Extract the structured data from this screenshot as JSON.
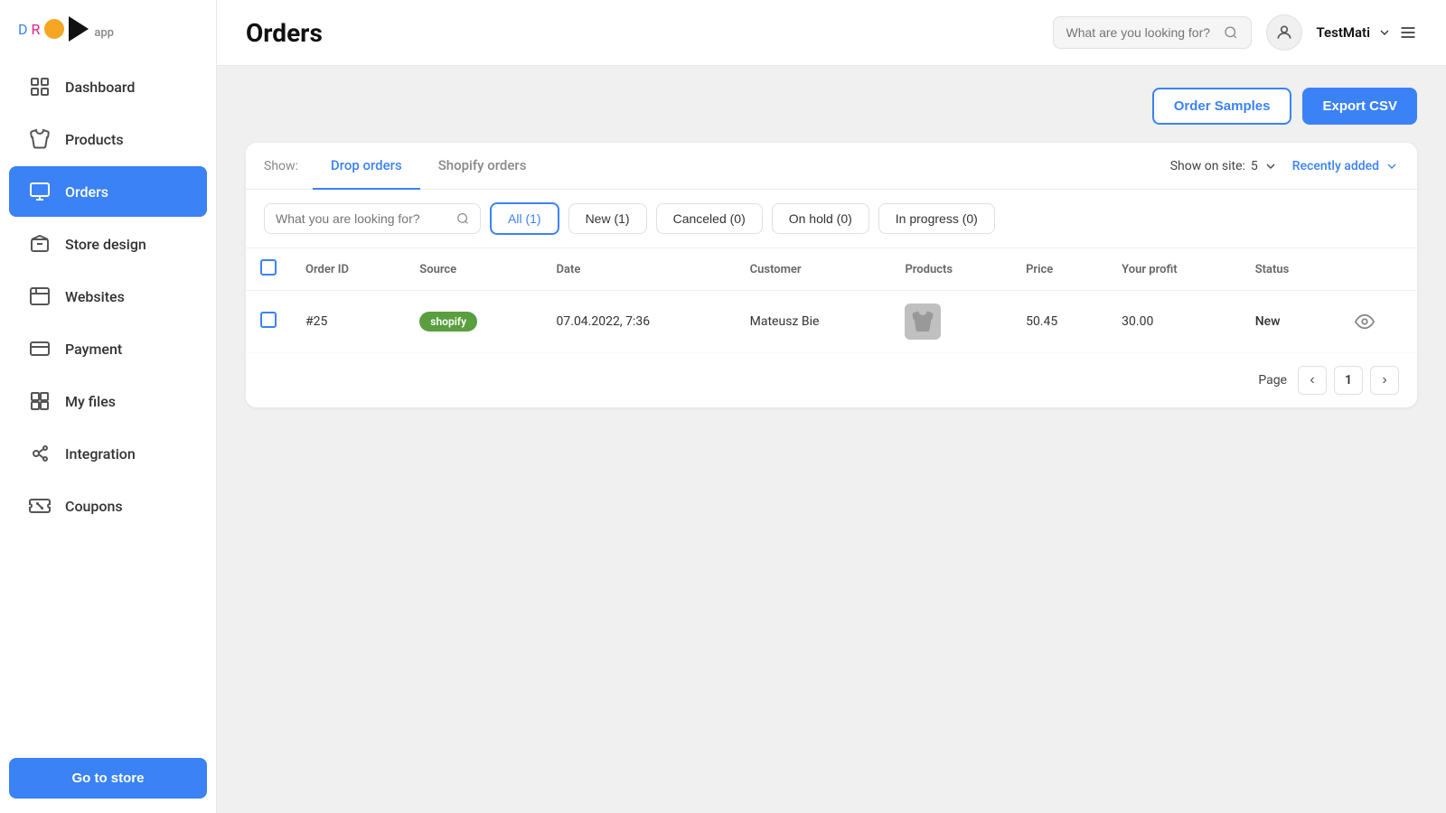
{
  "sidebar": {
    "logo": {
      "drop": "DROP",
      "app": "app"
    },
    "nav_items": [
      {
        "id": "dashboard",
        "label": "Dashboard",
        "active": false
      },
      {
        "id": "products",
        "label": "Products",
        "active": false
      },
      {
        "id": "orders",
        "label": "Orders",
        "active": true
      },
      {
        "id": "store-design",
        "label": "Store design",
        "active": false
      },
      {
        "id": "websites",
        "label": "Websites",
        "active": false
      },
      {
        "id": "payment",
        "label": "Payment",
        "active": false
      },
      {
        "id": "my-files",
        "label": "My files",
        "active": false
      },
      {
        "id": "integration",
        "label": "Integration",
        "active": false
      },
      {
        "id": "coupons",
        "label": "Coupons",
        "active": false
      }
    ],
    "go_to_store": "Go to store"
  },
  "header": {
    "title": "Orders",
    "search_placeholder": "What are you looking for?",
    "user": "TestMati"
  },
  "actions": {
    "order_samples": "Order Samples",
    "export_csv": "Export CSV"
  },
  "tabs": {
    "show_label": "Show:",
    "items": [
      {
        "id": "drop-orders",
        "label": "Drop orders",
        "active": true
      },
      {
        "id": "shopify-orders",
        "label": "Shopify orders",
        "active": false
      }
    ],
    "show_on_site_label": "Show on site:",
    "show_on_site_value": "5",
    "sort_label": "Recently added"
  },
  "filters": {
    "search_placeholder": "What you are looking for?",
    "buttons": [
      {
        "id": "all",
        "label": "All (1)",
        "active": true
      },
      {
        "id": "new",
        "label": "New (1)",
        "active": false
      },
      {
        "id": "canceled",
        "label": "Canceled (0)",
        "active": false
      },
      {
        "id": "on-hold",
        "label": "On hold (0)",
        "active": false
      },
      {
        "id": "in-progress",
        "label": "In progress (0)",
        "active": false
      }
    ]
  },
  "table": {
    "headers": [
      "Order ID",
      "Source",
      "Date",
      "Customer",
      "Products",
      "Price",
      "Your profit",
      "Status"
    ],
    "rows": [
      {
        "id": "#25",
        "source": "shopify",
        "date": "07.04.2022, 7:36",
        "customer": "Mateusz Bie",
        "price": "50.45",
        "profit": "30.00",
        "status": "New"
      }
    ]
  },
  "pagination": {
    "page_label": "Page",
    "current_page": "1"
  }
}
